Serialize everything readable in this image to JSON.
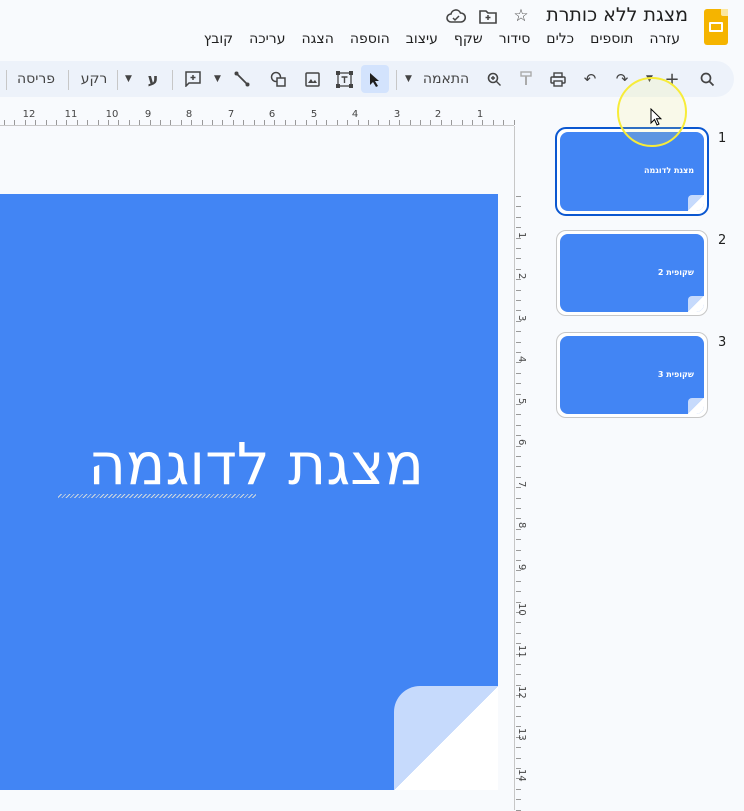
{
  "app": {
    "title": "מצגת ללא כותרת"
  },
  "menu": [
    "קובץ",
    "עריכה",
    "הצגה",
    "הוספה",
    "עיצוב",
    "שקף",
    "סידור",
    "כלים",
    "תוספים",
    "עזרה"
  ],
  "toolbar": {
    "zoom_label": "התאמה",
    "background_label": "רקע",
    "layout_label": "פריסה",
    "font_glyph": "ע"
  },
  "ruler": {
    "h_labels": [
      "12",
      "11",
      "10",
      "9",
      "8",
      "7",
      "6",
      "5",
      "4",
      "3",
      "2",
      "1"
    ],
    "v_labels": [
      "1",
      "2",
      "3",
      "4",
      "5",
      "6",
      "7",
      "8",
      "9",
      "10",
      "11",
      "12",
      "13",
      "14"
    ]
  },
  "slide": {
    "title": "מצגת לדוגמה"
  },
  "filmstrip": [
    {
      "number": "1",
      "title": "מצגת לדוגמה"
    },
    {
      "number": "2",
      "title": "שקופית 2"
    },
    {
      "number": "3",
      "title": "שקופית 3"
    }
  ],
  "colors": {
    "slide_bg": "#4285f4",
    "accent": "#0b57d0",
    "logo": "#f5b400"
  }
}
